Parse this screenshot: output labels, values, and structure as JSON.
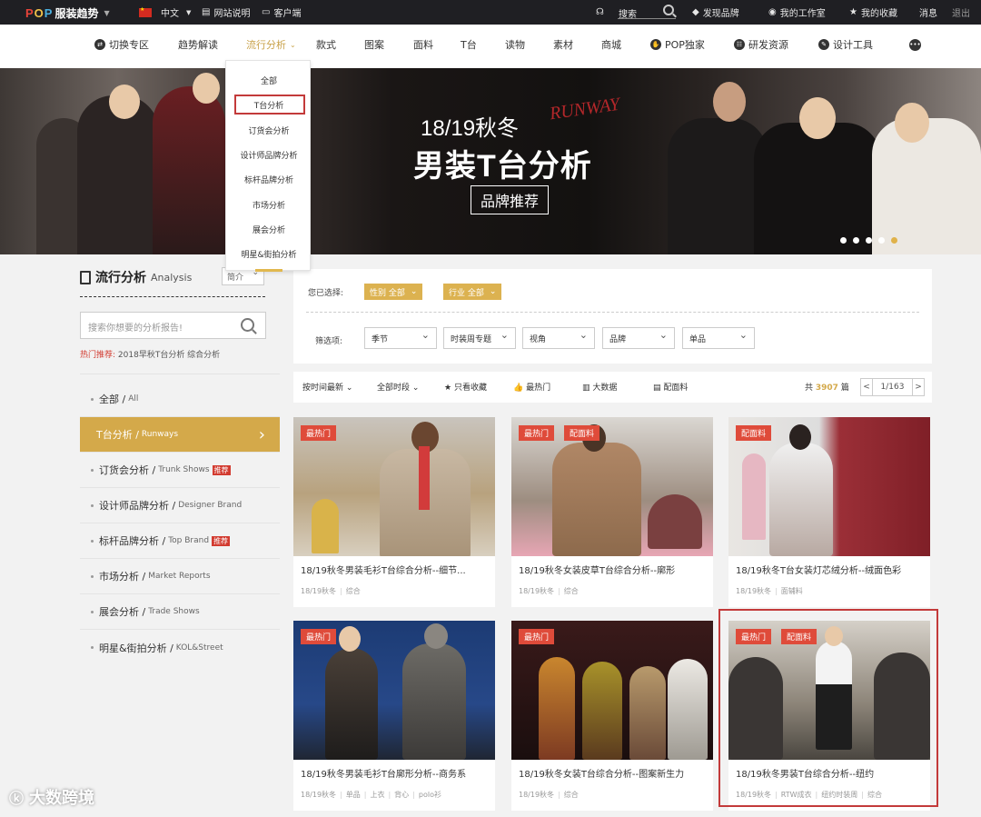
{
  "topbar": {
    "logo_text": "POP",
    "brand": "服装趋势",
    "language": "中文",
    "site_guide": "网站说明",
    "client": "客户端",
    "search_placeholder": "搜索",
    "discover": "发现品牌",
    "workspace": "我的工作室",
    "favorites": "我的收藏",
    "messages": "消息",
    "logout": "退出"
  },
  "nav": {
    "items": [
      "切换专区",
      "趋势解读",
      "流行分析",
      "款式",
      "图案",
      "面料",
      "T台",
      "读物",
      "素材",
      "商城",
      "POP独家",
      "研发资源",
      "设计工具"
    ]
  },
  "dropdown": {
    "items": [
      "全部",
      "T台分析",
      "订货会分析",
      "设计师品牌分析",
      "标杆品牌分析",
      "市场分析",
      "展会分析",
      "明星&街拍分析"
    ]
  },
  "banner": {
    "season": "18/19秋冬",
    "runway": "RUNWAY",
    "title": "男装T台分析",
    "subtitle": "品牌推荐"
  },
  "sidebar": {
    "title": "流行分析",
    "title_en": "Analysis",
    "intro": "简介",
    "search_placeholder": "搜索你想要的分析报告!",
    "hot_label": "热门推荐:",
    "hot_items": "2018早秋T台分析  综合分析",
    "categories": [
      {
        "cn": "全部 /",
        "en": "All"
      },
      {
        "cn": "T台分析 /",
        "en": "Runways"
      },
      {
        "cn": "订货会分析 /",
        "en": "Trunk Shows",
        "tag": "推荐"
      },
      {
        "cn": "设计师品牌分析 /",
        "en": "Designer Brand"
      },
      {
        "cn": "标杆品牌分析 /",
        "en": "Top Brand",
        "tag": "推荐"
      },
      {
        "cn": "市场分析 /",
        "en": "Market Reports"
      },
      {
        "cn": "展会分析 /",
        "en": "Trade Shows"
      },
      {
        "cn": "明星&街拍分析 /",
        "en": "KOL&Street"
      }
    ]
  },
  "filters": {
    "selected_label": "您已选择:",
    "chips": [
      "性别  全部",
      "行业  全部"
    ],
    "filter_label": "筛选项:",
    "selects": [
      "季节",
      "时装周专题",
      "视角",
      "品牌",
      "单品"
    ]
  },
  "toolbar": {
    "sort": "按时间最新",
    "period": "全部时段",
    "fav_only": "只看收藏",
    "hottest": "最热门",
    "bigdata": "大数据",
    "fabric": "配面料",
    "count_prefix": "共",
    "count": "3907",
    "count_suffix": "篇",
    "prev": "<",
    "page": "1/163",
    "next": ">"
  },
  "cards": [
    {
      "title": "18/19秋冬男装毛衫T台综合分析--细节...",
      "badges": [
        "最热门"
      ],
      "tags": [
        "18/19秋冬",
        "综合"
      ]
    },
    {
      "title": "18/19秋冬女装皮草T台综合分析--廓形",
      "badges": [
        "最热门",
        "配面料"
      ],
      "tags": [
        "18/19秋冬",
        "综合"
      ]
    },
    {
      "title": "18/19秋冬T台女装灯芯绒分析--绒面色彩",
      "badges": [
        "配面料"
      ],
      "tags": [
        "18/19秋冬",
        "面辅料"
      ]
    },
    {
      "title": "18/19秋冬男装毛衫T台廓形分析--商务系",
      "badges": [
        "最热门"
      ],
      "tags": [
        "18/19秋冬",
        "单品",
        "上衣",
        "背心",
        "polo衫"
      ]
    },
    {
      "title": "18/19秋冬女装T台综合分析--图案新生力",
      "badges": [
        "最热门"
      ],
      "tags": [
        "18/19秋冬",
        "综合"
      ]
    },
    {
      "title": "18/19秋冬男装T台综合分析--纽约",
      "badges": [
        "最热门",
        "配面料"
      ],
      "tags": [
        "18/19秋冬",
        "RTW成衣",
        "纽约时装周",
        "综合"
      ]
    }
  ],
  "watermark": "大数跨境"
}
